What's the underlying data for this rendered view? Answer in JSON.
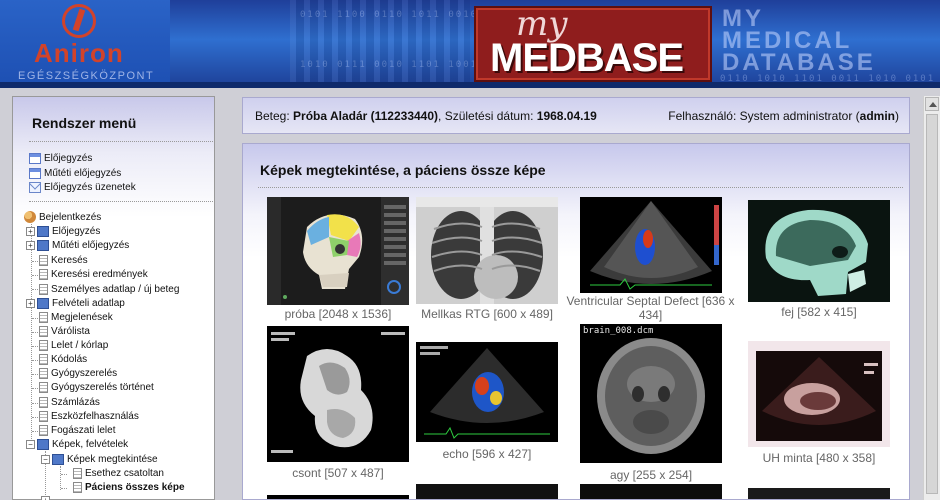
{
  "header": {
    "logo_name": "Aniron",
    "logo_sub": "EGÉSZSÉGKÖZPONT",
    "brand_my": "my",
    "brand_med": "MEDBASE",
    "brand_tag_1": "MY",
    "brand_tag_2": "MEDICAL",
    "brand_tag_3": "DATABASE"
  },
  "sidebar": {
    "title": "Rendszer menü",
    "quick_links": [
      "Előjegyzés",
      "Műtéti előjegyzés",
      "Előjegyzés üzenetek"
    ],
    "tree_root": "Bejelentkezés",
    "tree": [
      {
        "label": "Előjegyzés",
        "kind": "book"
      },
      {
        "label": "Műtéti előjegyzés",
        "kind": "book"
      },
      {
        "label": "Keresés",
        "kind": "doc"
      },
      {
        "label": "Keresési eredmények",
        "kind": "doc"
      },
      {
        "label": "Személyes adatlap / új beteg",
        "kind": "doc"
      },
      {
        "label": "Felvételi adatlap",
        "kind": "book"
      },
      {
        "label": "Megjelenések",
        "kind": "doc"
      },
      {
        "label": "Várólista",
        "kind": "doc"
      },
      {
        "label": "Lelet / kórlap",
        "kind": "doc"
      },
      {
        "label": "Kódolás",
        "kind": "doc"
      },
      {
        "label": "Gyógyszerelés",
        "kind": "doc"
      },
      {
        "label": "Gyógyszerelés történet",
        "kind": "doc"
      },
      {
        "label": "Számlázás",
        "kind": "doc"
      },
      {
        "label": "Eszközfelhasználás",
        "kind": "doc"
      },
      {
        "label": "Fogászati lelet",
        "kind": "doc"
      },
      {
        "label": "Képek, felvételek",
        "kind": "book"
      },
      {
        "label": "Képek megtekintése",
        "kind": "book"
      },
      {
        "label": "Esethez csatoltan",
        "kind": "doc"
      },
      {
        "label": "Páciens összes képe",
        "kind": "doc"
      }
    ]
  },
  "patient_bar": {
    "patient_label": "Beteg:",
    "patient_name": "Próba Aladár (112233440)",
    "dob_label": ", Születési dátum:",
    "dob": "1968.04.19",
    "user_label": "Felhasználó: System administrator (",
    "user_name": "admin",
    "user_close": ")"
  },
  "main": {
    "title": "Képek megtekintése, a páciens össze képe",
    "images": [
      {
        "caption": "próba [2048 x 1536]"
      },
      {
        "caption": "Mellkas RTG [600 x 489]"
      },
      {
        "caption": "Ventricular Septal Defect [636 x 434]"
      },
      {
        "caption": "fej [582 x 415]"
      },
      {
        "caption": "csont [507 x 487]"
      },
      {
        "caption": "echo [596 x 427]"
      },
      {
        "caption": "agy [255 x 254]"
      },
      {
        "caption": "UH minta [480 x 358]"
      }
    ],
    "brain_label": "brain_008.dcm"
  }
}
